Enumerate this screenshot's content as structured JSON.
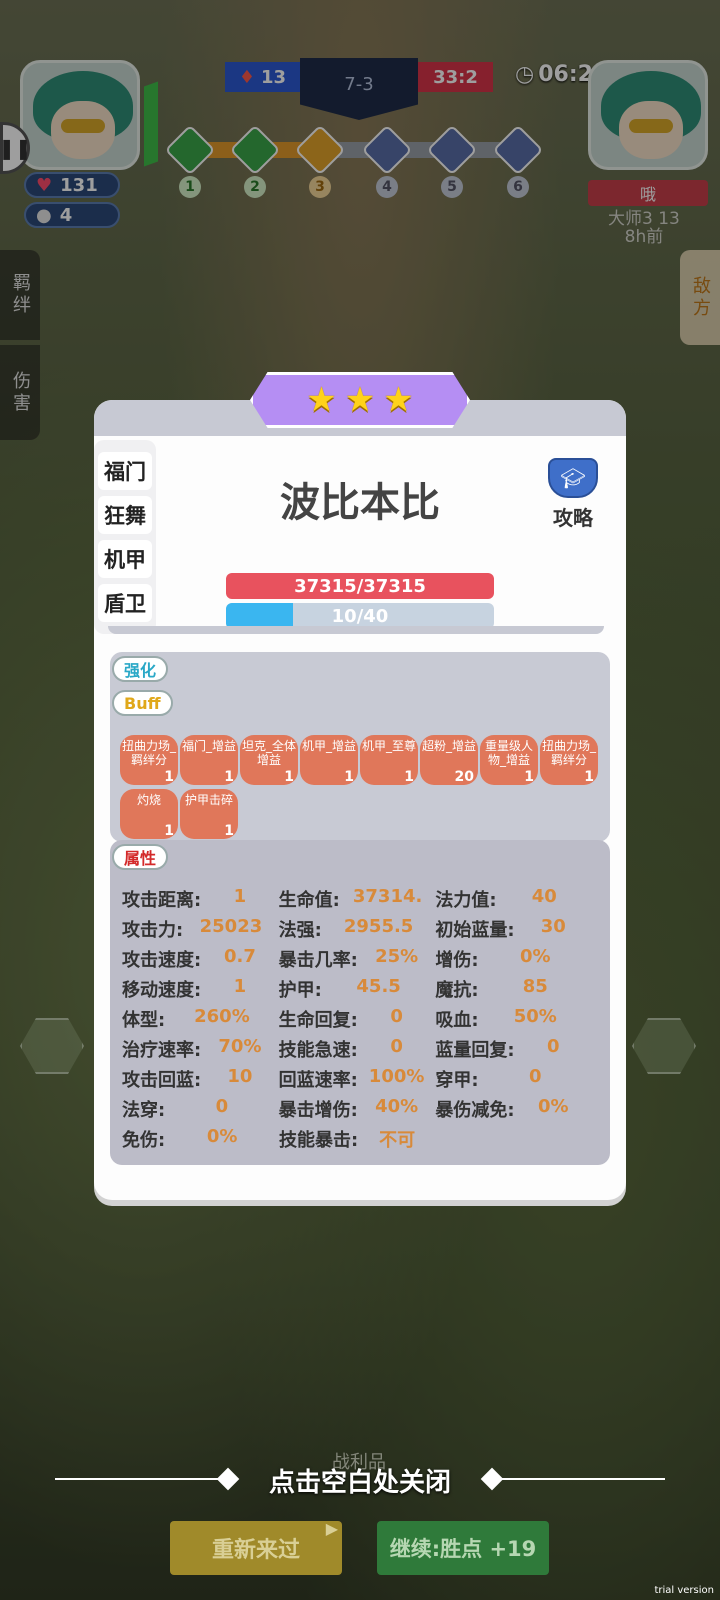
{
  "hud": {
    "left_hp": "131",
    "left_coins": "4",
    "blue_score": "13",
    "round": "7-3",
    "red_score": "33:2",
    "timer": "06:2",
    "stages": [
      "1",
      "2",
      "3",
      "4",
      "5",
      "6"
    ],
    "stage_progress": 0.45,
    "enemy_name": "哦",
    "enemy_rank": "大师3 13",
    "enemy_time": "8h前"
  },
  "side_tabs": {
    "bond": "羁绊",
    "damage": "伤害",
    "enemy": "敌方"
  },
  "unit": {
    "stars": 3,
    "name": "波比本比",
    "strategy_label": "攻略",
    "tags": [
      "福门",
      "狂舞",
      "机甲",
      "盾卫"
    ],
    "hp_text": "37315/37315",
    "mp_text": "10/40",
    "mp_fraction": 0.25
  },
  "sections": {
    "enhance": "强化",
    "buff": "Buff",
    "attributes": "属性"
  },
  "buffs": [
    {
      "name": "扭曲力场_羁绊分",
      "count": "1"
    },
    {
      "name": "福门_增益",
      "count": "1"
    },
    {
      "name": "坦克_全体增益",
      "count": "1"
    },
    {
      "name": "机甲_增益",
      "count": "1"
    },
    {
      "name": "机甲_至尊",
      "count": "1"
    },
    {
      "name": "超粉_增益",
      "count": "20"
    },
    {
      "name": "重量级人物_增益",
      "count": "1"
    },
    {
      "name": "扭曲力场_羁绊分",
      "count": "1"
    },
    {
      "name": "灼烧",
      "count": "1"
    },
    {
      "name": "护甲击碎",
      "count": "1"
    }
  ],
  "attributes": [
    [
      {
        "k": "攻击距离:",
        "v": "1"
      },
      {
        "k": "生命值:",
        "v": "37314."
      },
      {
        "k": "法力值:",
        "v": "40"
      }
    ],
    [
      {
        "k": "攻击力:",
        "v": "25023"
      },
      {
        "k": "法强:",
        "v": "2955.5"
      },
      {
        "k": "初始蓝量:",
        "v": "30"
      }
    ],
    [
      {
        "k": "攻击速度:",
        "v": "0.7"
      },
      {
        "k": "暴击几率:",
        "v": "25%"
      },
      {
        "k": "增伤:",
        "v": "0%"
      }
    ],
    [
      {
        "k": "移动速度:",
        "v": "1"
      },
      {
        "k": "护甲:",
        "v": "45.5"
      },
      {
        "k": "魔抗:",
        "v": "85"
      }
    ],
    [
      {
        "k": "体型:",
        "v": "260%"
      },
      {
        "k": "生命回复:",
        "v": "0"
      },
      {
        "k": "吸血:",
        "v": "50%"
      }
    ],
    [
      {
        "k": "治疗速率:",
        "v": "70%"
      },
      {
        "k": "技能急速:",
        "v": "0"
      },
      {
        "k": "蓝量回复:",
        "v": "0"
      }
    ],
    [
      {
        "k": "攻击回蓝:",
        "v": "10"
      },
      {
        "k": "回蓝速率:",
        "v": "100%"
      },
      {
        "k": "穿甲:",
        "v": "0"
      }
    ],
    [
      {
        "k": "法穿:",
        "v": "0"
      },
      {
        "k": "暴击增伤:",
        "v": "40%"
      },
      {
        "k": "暴伤减免:",
        "v": "0%"
      }
    ],
    [
      {
        "k": "免伤:",
        "v": "0%"
      },
      {
        "k": "技能暴击:",
        "v": "不可"
      }
    ]
  ],
  "footer": {
    "close_hint": "点击空白处关闭",
    "loot": "战利品",
    "retry": "重新来过",
    "continue": "继续:胜点 +19",
    "watermark": "trial version"
  },
  "colors": {
    "hp": "#e8525e",
    "mp": "#3ab6f0",
    "buff": "#e0775a",
    "stars_banner": "#b58ef3"
  }
}
